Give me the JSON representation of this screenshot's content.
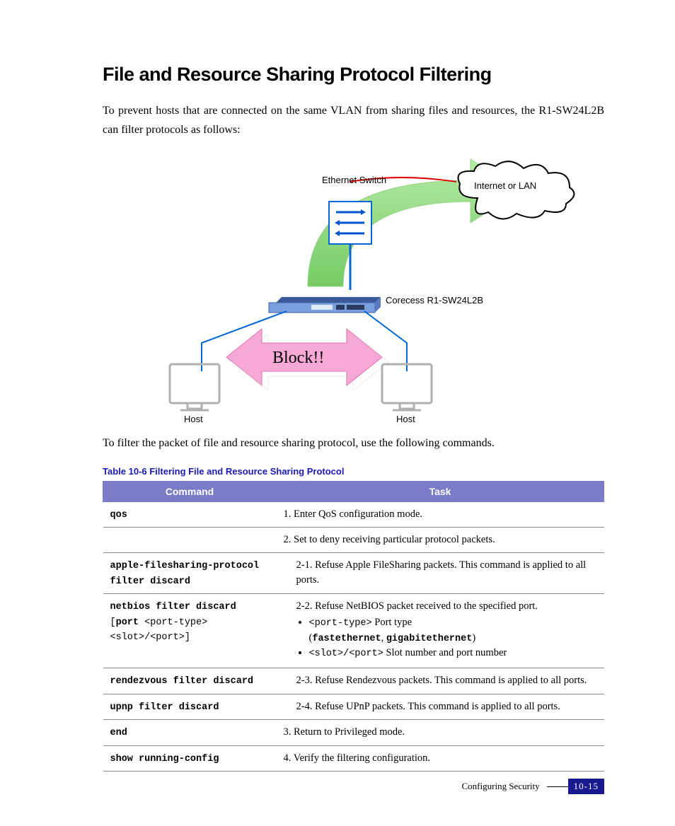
{
  "heading": "File and Resource Sharing Protocol Filtering",
  "intro": "To prevent hosts that are connected on the same VLAN from sharing files and resources, the R1-SW24L2B can filter protocols as follows:",
  "diagram": {
    "ethernet_switch": "Ethernet Switch",
    "internet": "Internet or LAN",
    "device": "Corecess R1-SW24L2B",
    "block": "Block!!",
    "host_left": "Host",
    "host_right": "Host"
  },
  "para2": "To filter the packet of file and resource sharing protocol, use the following commands.",
  "table_caption": "Table 10-6    Filtering File and Resource Sharing Protocol",
  "thead": {
    "c1": "Command",
    "c2": "Task"
  },
  "rows": {
    "r1": {
      "cmd": "qos",
      "task": "1. Enter QoS configuration mode."
    },
    "r2": {
      "cmd": "",
      "task": "2. Set to deny receiving particular protocol packets."
    },
    "r3": {
      "cmd_l1": "apple-filesharing-protocol",
      "cmd_l2": "filter discard",
      "task": "2-1. Refuse Apple FileSharing packets. This command is applied to all ports."
    },
    "r4": {
      "cmd_l1": "netbios filter discard",
      "cmd_l2a": "[",
      "cmd_l2b": "port",
      "cmd_l2c": " <port-type>",
      "cmd_l3": "<slot>/<port>]",
      "task_l1": "2-2. Refuse NetBIOS packet received to the specified port.",
      "b1a": "<port-type>",
      "b1b": " Port type",
      "b1c_open": "(",
      "b1c_fe": "fastethernet",
      "b1c_sep": ", ",
      "b1c_ge": "gigabitethernet",
      "b1c_close": ")",
      "b2a": "<slot>/<port>",
      "b2b": " Slot number and port number"
    },
    "r5": {
      "cmd": "rendezvous filter discard",
      "task": "2-3. Refuse Rendezvous packets. This command is applied to all ports."
    },
    "r6": {
      "cmd": "upnp filter discard",
      "task": "2-4. Refuse UPnP packets. This command is applied to all ports."
    },
    "r7": {
      "cmd": "end",
      "task": "3. Return to Privileged mode."
    },
    "r8": {
      "cmd": "show running-config",
      "task": "4. Verify the filtering configuration."
    }
  },
  "footer": {
    "text": "Configuring Security",
    "page": "10-15"
  }
}
